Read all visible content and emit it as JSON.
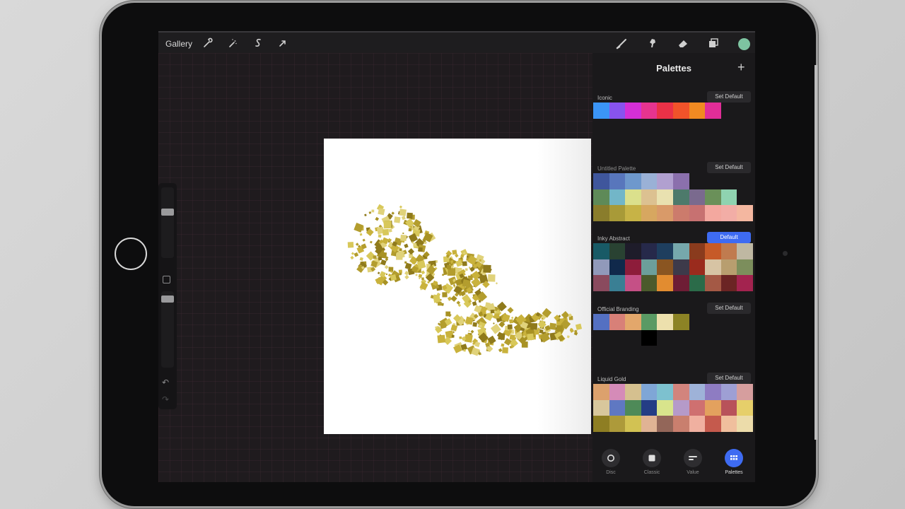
{
  "toolbar": {
    "gallery": "Gallery",
    "left_icons": [
      "wrench-icon",
      "magic-wand-icon",
      "selection-s-icon",
      "arrow-cursor-icon"
    ],
    "right_icons": [
      "brush-icon",
      "smudge-icon",
      "eraser-icon",
      "layers-icon"
    ],
    "current_color": "#7ec4a1"
  },
  "panel": {
    "title": "Palettes",
    "palettes": [
      {
        "name": "Iconic",
        "button": "Set Default",
        "default": false,
        "colors": [
          "#3b95f6",
          "#8853ef",
          "#d42fd6",
          "#e6348f",
          "#ea3147",
          "#f0532a",
          "#f08a22",
          "#e12d98"
        ]
      },
      {
        "name": "Untitled Palette",
        "button": "Set Default",
        "default": false,
        "colors": [
          "#3f569c",
          "#5876bc",
          "#6e98cc",
          "#9ab1d6",
          "#b1a0d0",
          "#8b70ad",
          "",
          "",
          "",
          "",
          "#5e8a58",
          "#72b6c8",
          "#dbe08c",
          "#dcc191",
          "#e9e1b0",
          "#4d7a6b",
          "#7a6a8e",
          "#6a9059",
          "#8fd3b0",
          "",
          "#8a7d2c",
          "#a89a38",
          "#c7b346",
          "#d7a760",
          "#d99a69",
          "#cc7b6c",
          "#c77171",
          "#f3a89f",
          "#f2ada6",
          "#f4b7a0"
        ]
      },
      {
        "name": "Inky Abstract",
        "button": "Default",
        "default": true,
        "colors": [
          "#185a66",
          "#294232",
          "#1e1c2a",
          "#26294a",
          "#1e3e5e",
          "#76a8ac",
          "#8a3b1d",
          "#c65a28",
          "#c07b4f",
          "#bfb8a2",
          "#9199ba",
          "#10294b",
          "#8d1c3a",
          "#6c9f9a",
          "#8a5521",
          "#3d3a4a",
          "#9a2b1d",
          "#d7c4a4",
          "#b89e6f",
          "#7c8e5c",
          "#8a4a5e",
          "#3a7f94",
          "#c55086",
          "#4b5a2c",
          "#e28c30",
          "#6e1d35",
          "#2b6b49",
          "#a45945",
          "#6b2424",
          "#a3234f"
        ]
      },
      {
        "name": "Official Branding",
        "button": "Set Default",
        "default": false,
        "colors": [
          "#5470c2",
          "#d88078",
          "#e3a76b",
          "#5a9a64",
          "#ede0ad",
          "#8c8325",
          "",
          "",
          "",
          "",
          "",
          "",
          "",
          "#000000"
        ]
      },
      {
        "name": "Liquid Gold",
        "button": "Set Default",
        "default": false,
        "colors": [
          "#dca16d",
          "#d58bb8",
          "#d5c08f",
          "#7fa6d6",
          "#7dc1cf",
          "#d2847d",
          "#9eb2d8",
          "#8e7cc2",
          "#9e9fd4",
          "#d69e9e",
          "#d8c79c",
          "#5f78c2",
          "#4e8a58",
          "#243d85",
          "#d8e48c",
          "#b59ac9",
          "#cf7070",
          "#e3a15e",
          "#b8525a",
          "#e6cf6a",
          "#8e7e23",
          "#ad9a3a",
          "#d2c253",
          "#e0b394",
          "#936659",
          "#c97f6e",
          "#f0b0a0",
          "#c55a4d",
          "#f0bf9d",
          "#ecdcaa"
        ]
      }
    ]
  },
  "modes": [
    {
      "label": "Disc",
      "icon": "disc-icon",
      "active": false
    },
    {
      "label": "Classic",
      "icon": "classic-square-icon",
      "active": false
    },
    {
      "label": "Value",
      "icon": "value-sliders-icon",
      "active": false
    },
    {
      "label": "Palettes",
      "icon": "palettes-grid-icon",
      "active": true
    }
  ]
}
